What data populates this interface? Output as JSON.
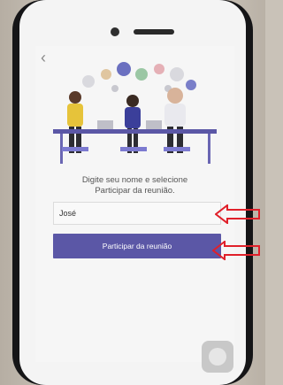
{
  "screen": {
    "back_icon": "chevron-left-icon",
    "instruction_line1": "Digite seu nome e selecione",
    "instruction_line2": "Participar da reunião.",
    "name_input_value": "José",
    "join_button_label": "Participar da reunião"
  },
  "colors": {
    "accent": "#5b57a6",
    "annotation_arrow": "#e0202a"
  }
}
